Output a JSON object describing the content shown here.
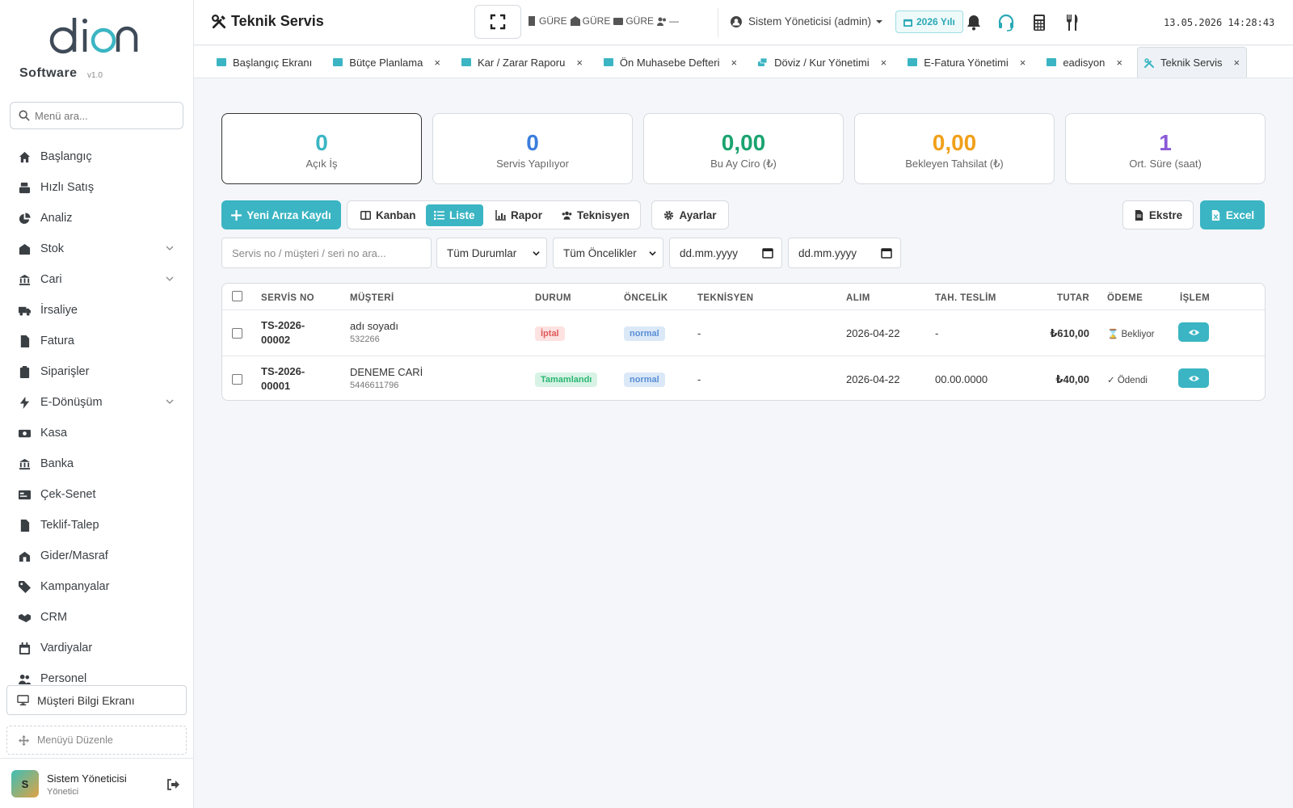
{
  "brand": {
    "logo_text": "dion",
    "name": "Software",
    "version": "v1.0"
  },
  "sidebar": {
    "search_placeholder": "Menü ara...",
    "items": [
      {
        "label": "Başlangıç",
        "icon": "home-icon"
      },
      {
        "label": "Hızlı Satış",
        "icon": "cash-register-icon"
      },
      {
        "label": "Analiz",
        "icon": "pie-chart-icon"
      },
      {
        "label": "Stok",
        "icon": "warehouse-icon",
        "expandable": true
      },
      {
        "label": "Cari",
        "icon": "bank-icon",
        "expandable": true
      },
      {
        "label": "İrsaliye",
        "icon": "truck-icon"
      },
      {
        "label": "Fatura",
        "icon": "invoice-icon"
      },
      {
        "label": "Siparişler",
        "icon": "clipboard-icon"
      },
      {
        "label": "E-Dönüşüm",
        "icon": "bolt-icon",
        "expandable": true
      },
      {
        "label": "Kasa",
        "icon": "money-icon"
      },
      {
        "label": "Banka",
        "icon": "bank-icon"
      },
      {
        "label": "Çek-Senet",
        "icon": "card-icon"
      },
      {
        "label": "Teklif-Talep",
        "icon": "document-icon"
      },
      {
        "label": "Gider/Masraf",
        "icon": "expense-icon"
      },
      {
        "label": "Kampanyalar",
        "icon": "tag-icon"
      },
      {
        "label": "CRM",
        "icon": "handshake-icon"
      },
      {
        "label": "Vardiyalar",
        "icon": "calendar-icon"
      },
      {
        "label": "Personel",
        "icon": "users-icon"
      }
    ],
    "customer_screen": "Müşteri Bilgi Ekranı",
    "edit_menu": "Menüyü Düzenle",
    "user": {
      "initial": "S",
      "name": "Sistem Yöneticisi",
      "role": "Yönetici"
    }
  },
  "topbar": {
    "title": "Teknik Servis",
    "status_items": [
      "GÜRE",
      "GÜRE",
      "GÜRE",
      "—"
    ],
    "user_label": "Sistem Yöneticisi (admin)",
    "year_label": "2026 Yılı",
    "datetime": "13.05.2026 14:28:43"
  },
  "tabs": [
    {
      "label": "Başlangıç Ekranı",
      "closable": false
    },
    {
      "label": "Bütçe Planlama",
      "closable": true
    },
    {
      "label": "Kar / Zarar Raporu",
      "closable": true
    },
    {
      "label": "Ön Muhasebe Defteri",
      "closable": true
    },
    {
      "label": "Döviz / Kur Yönetimi",
      "closable": true
    },
    {
      "label": "E-Fatura Yönetimi",
      "closable": true
    },
    {
      "label": "eadisyon",
      "closable": true
    },
    {
      "label": "Teknik Servis",
      "closable": true,
      "active": true
    }
  ],
  "stats": [
    {
      "value": "0",
      "label": "Açık İş",
      "color": "#3bb5c3"
    },
    {
      "value": "0",
      "label": "Servis Yapılıyor",
      "color": "#3b7ddd"
    },
    {
      "value": "0,00",
      "label": "Bu Ay Ciro (₺)",
      "color": "#1aa36f"
    },
    {
      "value": "0,00",
      "label": "Bekleyen Tahsilat (₺)",
      "color": "#f0a01a"
    },
    {
      "value": "1",
      "label": "Ort. Süre (saat)",
      "color": "#8a5ad6"
    }
  ],
  "actions": {
    "new_record": "Yeni Arıza Kaydı",
    "views": [
      "Kanban",
      "Liste",
      "Rapor",
      "Teknisyen"
    ],
    "active_view": "Liste",
    "settings": "Ayarlar",
    "statement": "Ekstre",
    "excel": "Excel"
  },
  "filters": {
    "search_placeholder": "Servis no / müşteri / seri no ara...",
    "status": "Tüm Durumlar",
    "priority": "Tüm Öncelikler",
    "date_from": "dd.mm.yyyy",
    "date_to": "dd.mm.yyyy"
  },
  "table": {
    "headers": [
      "SERVİS NO",
      "MÜŞTERİ",
      "DURUM",
      "ÖNCELİK",
      "TEKNİSYEN",
      "ALIM",
      "TAH. TESLİM",
      "TUTAR",
      "ÖDEME",
      "İŞLEM"
    ],
    "rows": [
      {
        "service_no": [
          "TS-2026-",
          "00002"
        ],
        "customer": "adı soyadı",
        "phone": "532266",
        "status": "İptal",
        "status_bg": "#fde2e2",
        "status_fg": "#e05a5a",
        "priority": "normal",
        "technician": "-",
        "received": "2026-04-22",
        "delivery": "-",
        "amount": "₺610,00",
        "payment": "⌛ Bekliyor"
      },
      {
        "service_no": [
          "TS-2026-",
          "00001"
        ],
        "customer": "DENEME CARİ",
        "phone": "5446611796",
        "status": "Tamamlandı",
        "status_bg": "#d8f3e5",
        "status_fg": "#2bb673",
        "priority": "normal",
        "technician": "-",
        "received": "2026-04-22",
        "delivery": "00.00.0000",
        "amount": "₺40,00",
        "payment": "✓ Ödendi"
      }
    ]
  },
  "colors": {
    "accent": "#3bb5c3",
    "priority_bg": "#dbe8f7",
    "priority_fg": "#5a8fd6"
  }
}
